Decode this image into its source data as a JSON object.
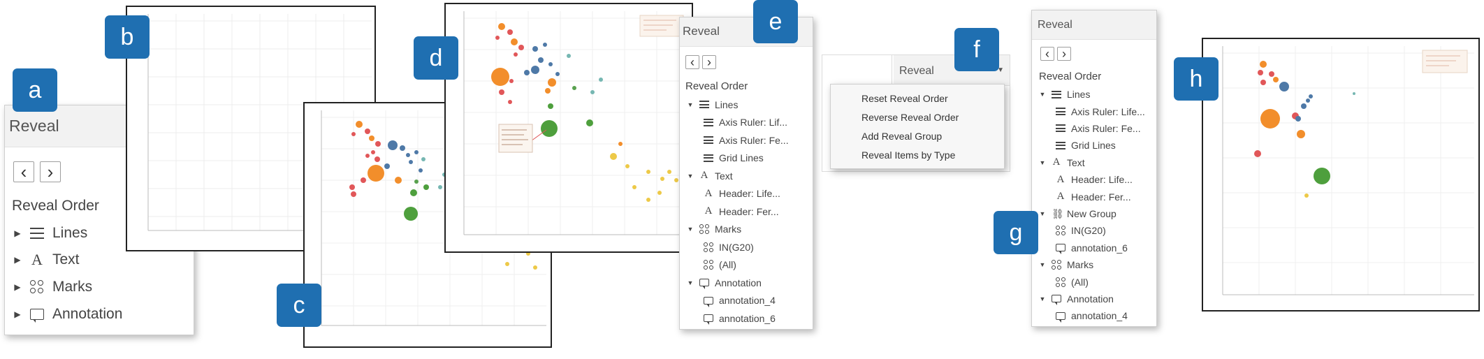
{
  "badges": [
    "a",
    "b",
    "c",
    "d",
    "e",
    "f",
    "g",
    "h"
  ],
  "panel_a": {
    "title": "Reveal",
    "prev": "‹",
    "next": "›",
    "order_title": "Reveal Order",
    "items": [
      {
        "label": "Lines",
        "icon": "lines-icon"
      },
      {
        "label": "Text",
        "icon": "text-icon"
      },
      {
        "label": "Marks",
        "icon": "marks-icon"
      },
      {
        "label": "Annotation",
        "icon": "annotation-icon"
      }
    ]
  },
  "panel_e": {
    "title": "Reveal",
    "order_title": "Reveal Order",
    "items": [
      {
        "label": "Lines",
        "level": 0
      },
      {
        "label": "Axis Ruler: Lif...",
        "level": 1
      },
      {
        "label": "Axis Ruler: Fe...",
        "level": 1
      },
      {
        "label": "Grid Lines",
        "level": 1
      },
      {
        "label": "Text",
        "level": 0
      },
      {
        "label": "Header: Life...",
        "level": 1
      },
      {
        "label": "Header: Fer...",
        "level": 1
      },
      {
        "label": "Marks",
        "level": 0
      },
      {
        "label": "IN(G20)",
        "level": 1
      },
      {
        "label": "(All)",
        "level": 1
      },
      {
        "label": "Annotation",
        "level": 0
      },
      {
        "label": "annotation_4",
        "level": 1
      },
      {
        "label": "annotation_6",
        "level": 1
      }
    ]
  },
  "panel_f": {
    "title": "Reveal",
    "menu": [
      "Reset Reveal Order",
      "Reverse Reveal Order",
      "Add Reveal Group",
      "Reveal Items by Type"
    ]
  },
  "panel_g": {
    "title": "Reveal",
    "order_title": "Reveal Order",
    "items": [
      {
        "label": "Lines",
        "level": 0
      },
      {
        "label": "Axis Ruler: Life...",
        "level": 1
      },
      {
        "label": "Axis Ruler: Fe...",
        "level": 1
      },
      {
        "label": "Grid Lines",
        "level": 1
      },
      {
        "label": "Text",
        "level": 0
      },
      {
        "label": "Header: Life...",
        "level": 1
      },
      {
        "label": "Header: Fer...",
        "level": 1
      },
      {
        "label": "New Group",
        "level": 0
      },
      {
        "label": "IN(G20)",
        "level": 1
      },
      {
        "label": "annotation_6",
        "level": 1
      },
      {
        "label": "Marks",
        "level": 0
      },
      {
        "label": "(All)",
        "level": 1
      },
      {
        "label": "Annotation",
        "level": 0
      },
      {
        "label": "annotation_4",
        "level": 1
      }
    ]
  },
  "colors": {
    "badge": "#1f6fb1",
    "orange": "#f28e2b",
    "green": "#4e9f3d",
    "blue": "#4e79a7",
    "red": "#e15759",
    "yellow": "#edc948"
  }
}
